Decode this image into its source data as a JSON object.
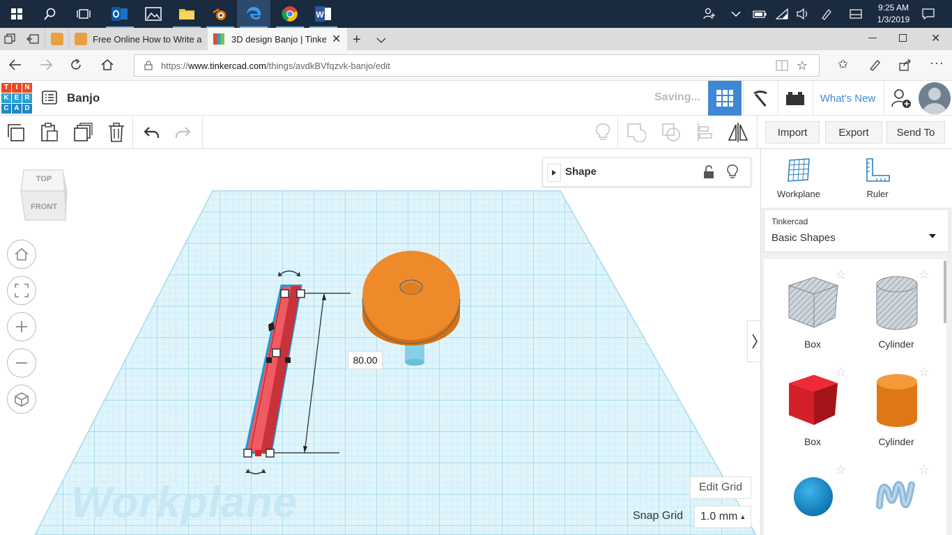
{
  "taskbar": {
    "clock_time": "9:25 AM",
    "clock_date": "1/3/2019"
  },
  "browser": {
    "tabs": [
      {
        "title": ""
      },
      {
        "title": "Free Online How to Write a"
      },
      {
        "title": "3D design Banjo | Tinke"
      }
    ],
    "url_prefix": "https://",
    "url_domain": "www.tinkercad.com",
    "url_path": "/things/avdkBVfqzvk-banjo/edit"
  },
  "app": {
    "logo_letters": [
      "T",
      "I",
      "N",
      "K",
      "E",
      "R",
      "C",
      "A",
      "D"
    ],
    "design_title": "Banjo",
    "status": "Saving...",
    "whats_new": "What's New"
  },
  "toolbar": {
    "import_label": "Import",
    "export_label": "Export",
    "send_to_label": "Send To"
  },
  "viewcube": {
    "top": "TOP",
    "front": "FRONT"
  },
  "inspector": {
    "title": "Shape"
  },
  "viewport": {
    "dimension_value": "80.00",
    "workplane_watermark": "Workplane",
    "edit_grid_label": "Edit Grid",
    "snap_grid_label": "Snap Grid",
    "snap_grid_value": "1.0 mm"
  },
  "right_panel": {
    "workplane_label": "Workplane",
    "ruler_label": "Ruler",
    "library_source": "Tinkercad",
    "library_name": "Basic Shapes",
    "shapes": [
      {
        "label": "Box"
      },
      {
        "label": "Cylinder"
      },
      {
        "label": "Box"
      },
      {
        "label": "Cylinder"
      }
    ]
  },
  "colors": {
    "taskbar_bg": "#1a2a3f",
    "accent_blue": "#3f88d4",
    "grid_blue": "#a9dcef",
    "shape_red": "#e23b45",
    "shape_orange": "#ee8a2a"
  }
}
